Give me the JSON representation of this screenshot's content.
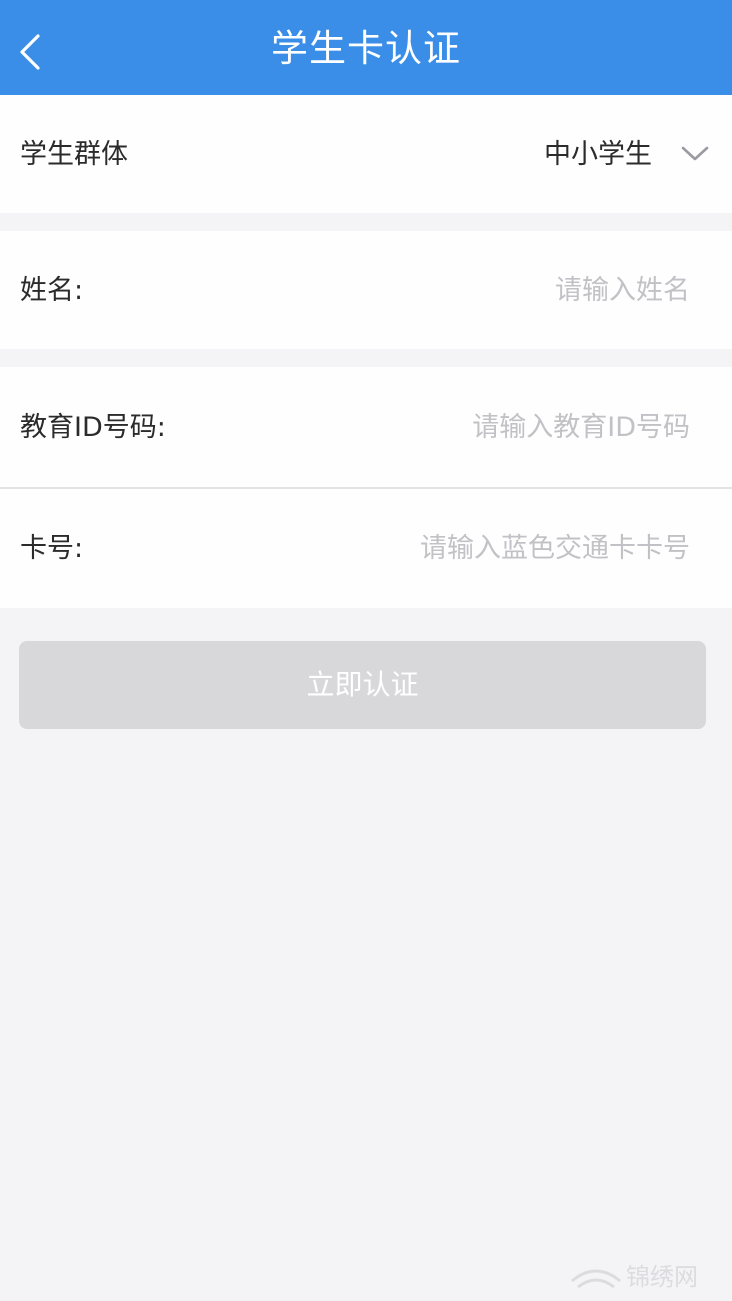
{
  "header": {
    "title": "学生卡认证",
    "back_icon": "chevron-left-icon",
    "background_color": "#3a8ee8"
  },
  "form": {
    "group": {
      "label": "学生群体",
      "value": "中小学生",
      "icon": "chevron-down-icon"
    },
    "name": {
      "label": "姓名:",
      "placeholder": "请输入姓名",
      "value": ""
    },
    "edu_id": {
      "label": "教育ID号码:",
      "placeholder": "请输入教育ID号码",
      "value": ""
    },
    "card_no": {
      "label": "卡号:",
      "placeholder": "请输入蓝色交通卡卡号",
      "value": ""
    }
  },
  "submit": {
    "label": "立即认证",
    "disabled": true,
    "background_color": "#d8d7da"
  },
  "watermark": {
    "text": "锦绣网"
  }
}
